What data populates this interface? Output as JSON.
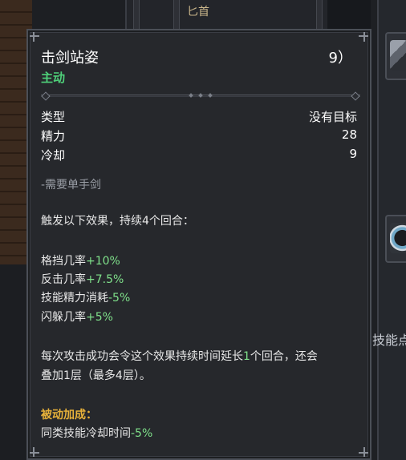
{
  "background": {
    "top_item_label": "匕首",
    "right_label": "技能点"
  },
  "tooltip": {
    "title": "击剑站姿",
    "title_suffix": "9）",
    "subtype": "主动",
    "stats": [
      {
        "label": "类型",
        "value": "没有目标"
      },
      {
        "label": "精力",
        "value": "28"
      },
      {
        "label": "冷却",
        "value": "9"
      }
    ],
    "requirement": "-需要单手剑",
    "trigger_prefix": "触发以下效果，持续",
    "trigger_count": "4",
    "trigger_suffix": "个回合：",
    "effects": [
      {
        "label": "格挡几率",
        "value": "+10%"
      },
      {
        "label": "反击几率",
        "value": "+7.5%"
      },
      {
        "label": "技能精力消耗",
        "value": "-5%"
      },
      {
        "label": "闪躲几率",
        "value": "+5%"
      }
    ],
    "extend_line1_prefix": "每次攻击成功会令这个效果持续时间延长",
    "extend_line1_num": "1",
    "extend_line1_suffix": "个回合，还会",
    "extend_line2": "叠加1层（最多4层）。",
    "passive_title": "被动加成：",
    "passive_label": "同类技能冷却时间",
    "passive_value": "-5%"
  },
  "colors": {
    "active_green": "#4fd17a",
    "bonus_green": "#7fe08a",
    "passive_gold": "#e8b23a"
  }
}
